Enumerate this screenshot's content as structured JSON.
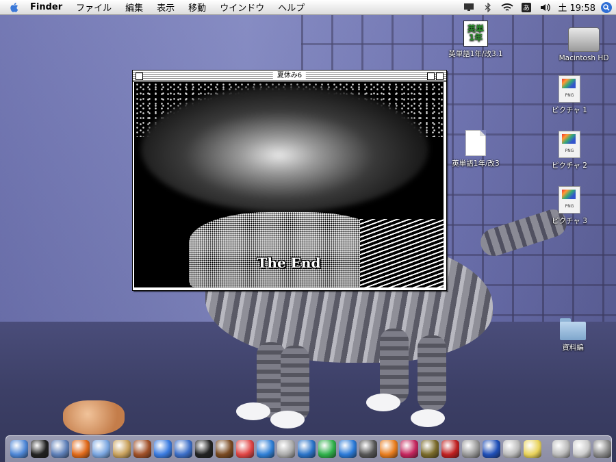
{
  "menubar": {
    "app_name": "Finder",
    "items": [
      "ファイル",
      "編集",
      "表示",
      "移動",
      "ウインドウ",
      "ヘルプ"
    ],
    "clock": "土 19:58"
  },
  "window": {
    "title": "夏休み6",
    "content_text": "The End"
  },
  "desktop_icons": {
    "eitango1": "英単語1年/改3.1",
    "kanji_label": "英単\n1年",
    "macintosh_hd": "Macintosh HD",
    "picture1": "ピクチャ 1",
    "picture2": "ピクチャ 2",
    "picture3": "ピクチャ 3",
    "eitango2": "英単語1年/改3",
    "shiryohen": "資料編",
    "png_label": "PNG"
  },
  "dock": {
    "apps": [
      "finder",
      "dashboard",
      "preview",
      "firefox",
      "ichat",
      "address-book",
      "iphoto",
      "itunes",
      "dvd",
      "imovie",
      "garageband",
      "ical",
      "quicktime",
      "system",
      "wifi",
      "network",
      "word",
      "terminal",
      "ibook",
      "indesign",
      "pages",
      "acrobat",
      "photos",
      "help",
      "printer",
      "stickies",
      "docs",
      "finder-window",
      "trash"
    ]
  },
  "colors": {
    "menubar_top": "#ffffff",
    "desktop_blue": "#6d72b0",
    "spotlight": "#2f6fd6"
  }
}
